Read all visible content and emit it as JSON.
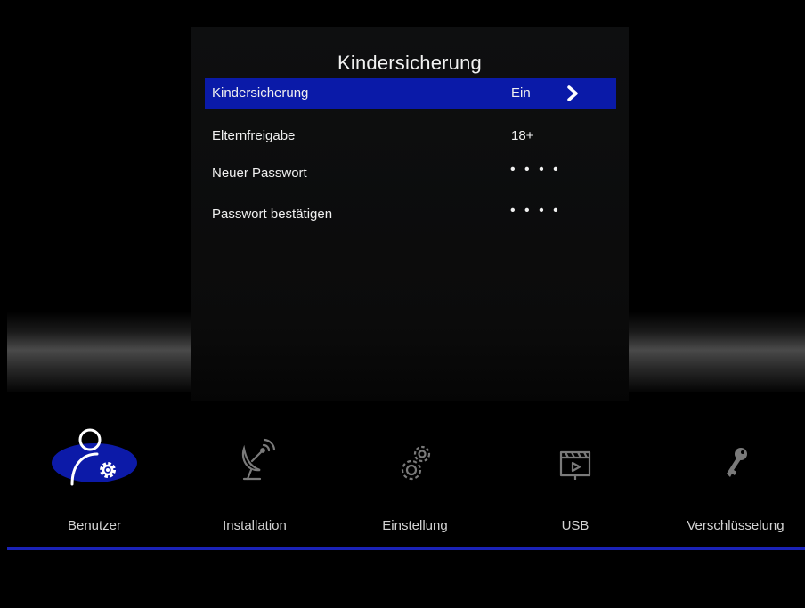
{
  "panel": {
    "title": "Kindersicherung",
    "rows": [
      {
        "label": "Kindersicherung",
        "value": "Ein"
      },
      {
        "label": "Elternfreigabe",
        "value": "18+"
      },
      {
        "label": "Neuer Passwort",
        "value": "• • • •"
      },
      {
        "label": "Passwort bestätigen",
        "value": "• • • •"
      }
    ]
  },
  "nav": [
    {
      "label": "Benutzer",
      "icon": "user-gear-icon"
    },
    {
      "label": "Installation",
      "icon": "satellite-dish-icon"
    },
    {
      "label": "Einstellung",
      "icon": "gears-icon"
    },
    {
      "label": "USB",
      "icon": "media-player-icon"
    },
    {
      "label": "Verschlüsselung",
      "icon": "key-icon"
    }
  ],
  "colors": {
    "selection": "#0a1aa8",
    "accent_line": "#1a22b8",
    "background": "#000000"
  }
}
